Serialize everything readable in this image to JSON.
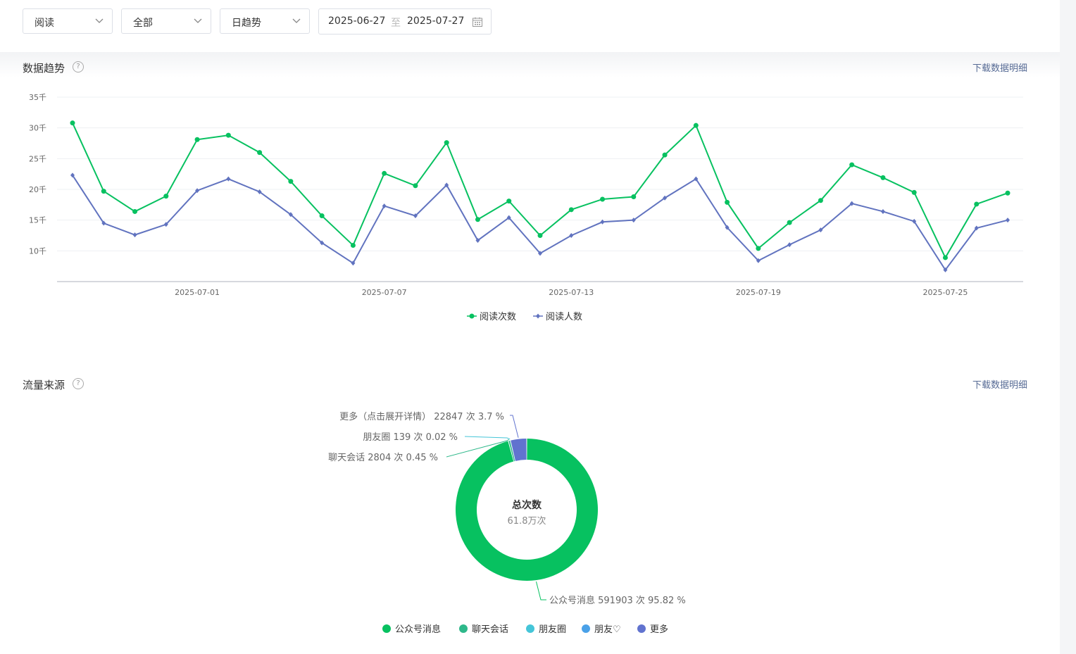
{
  "filters": {
    "metric_select": "阅读",
    "scope_select": "全部",
    "trend_select": "日趋势",
    "date_start": "2025-06-27",
    "date_separator": "至",
    "date_end": "2025-07-27"
  },
  "trend_section": {
    "title": "数据趋势",
    "help": "?",
    "download": "下载数据明细"
  },
  "traffic_section": {
    "title": "流量来源",
    "help": "?",
    "download": "下载数据明细"
  },
  "chart_data": [
    {
      "type": "line",
      "y_unit": "千",
      "ylim": [
        5,
        35
      ],
      "yticks": [
        "10千",
        "15千",
        "20千",
        "25千",
        "30千",
        "35千"
      ],
      "x": [
        "2025-06-27",
        "2025-06-28",
        "2025-06-29",
        "2025-06-30",
        "2025-07-01",
        "2025-07-02",
        "2025-07-03",
        "2025-07-04",
        "2025-07-05",
        "2025-07-06",
        "2025-07-07",
        "2025-07-08",
        "2025-07-09",
        "2025-07-10",
        "2025-07-11",
        "2025-07-12",
        "2025-07-13",
        "2025-07-14",
        "2025-07-15",
        "2025-07-16",
        "2025-07-17",
        "2025-07-18",
        "2025-07-19",
        "2025-07-20",
        "2025-07-21",
        "2025-07-22",
        "2025-07-23",
        "2025-07-24",
        "2025-07-25",
        "2025-07-26",
        "2025-07-27"
      ],
      "xticks": [
        "2025-07-01",
        "2025-07-07",
        "2025-07-13",
        "2025-07-19",
        "2025-07-25"
      ],
      "grid": true,
      "legend_position": "bottom-center",
      "series": [
        {
          "name": "阅读次数",
          "color": "#07c160",
          "marker": "circle",
          "values": [
            30.8,
            19.7,
            16.4,
            18.9,
            28.1,
            28.8,
            26.0,
            21.3,
            15.7,
            10.9,
            22.6,
            20.6,
            27.6,
            15.1,
            18.1,
            12.5,
            16.7,
            18.4,
            18.8,
            25.6,
            30.4,
            17.9,
            10.4,
            14.6,
            18.2,
            24.0,
            21.9,
            19.5,
            8.9,
            17.6,
            19.4
          ]
        },
        {
          "name": "阅读人数",
          "color": "#6173bf",
          "marker": "diamond",
          "values": [
            22.3,
            14.5,
            12.6,
            14.3,
            19.8,
            21.7,
            19.6,
            15.9,
            11.3,
            8.0,
            17.3,
            15.7,
            20.7,
            11.7,
            15.4,
            9.6,
            12.5,
            14.7,
            15.0,
            18.6,
            21.7,
            13.8,
            8.4,
            11.0,
            13.4,
            17.7,
            16.4,
            14.8,
            6.9,
            13.7,
            15.0
          ]
        }
      ]
    },
    {
      "type": "pie",
      "center_title": "总次数",
      "center_value": "61.8万次",
      "slices": [
        {
          "name": "公众号消息",
          "value": 591903,
          "percent": 95.82,
          "color": "#07c160",
          "label": "公众号消息 591903 次 95.82 %"
        },
        {
          "name": "聊天会话",
          "value": 2804,
          "percent": 0.45,
          "color": "#2eb88a",
          "label": "聊天会话 2804 次 0.45 %"
        },
        {
          "name": "朋友圈",
          "value": 139,
          "percent": 0.02,
          "color": "#45c5d8",
          "label": "朋友圈 139 次 0.02 %"
        },
        {
          "name": "朋友♡",
          "value": 0,
          "percent": 0,
          "color": "#4aa1e8",
          "label": ""
        },
        {
          "name": "更多",
          "value": 22847,
          "percent": 3.7,
          "color": "#6173cf",
          "label": "更多（点击展开详情） 22847 次 3.7 %"
        }
      ],
      "legend": [
        "公众号消息",
        "聊天会话",
        "朋友圈",
        "朋友♡",
        "更多"
      ],
      "legend_position": "bottom-center"
    }
  ]
}
